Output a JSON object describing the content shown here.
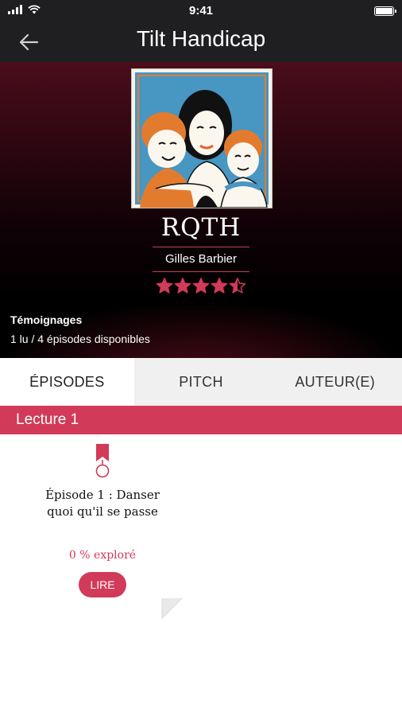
{
  "status_bar": {
    "time": "9:41"
  },
  "nav": {
    "title": "Tilt Handicap",
    "back_icon": "arrow-left-icon"
  },
  "book": {
    "title": "RQTH",
    "author": "Gilles Barbier",
    "rating": 4.5,
    "rating_max": 5,
    "genre": "Témoignages",
    "progress": "1 lu / 4 épisodes disponibles",
    "cover_icon": "illustrated-cover-three-people"
  },
  "tabs": [
    {
      "label": "ÉPISODES",
      "active": true
    },
    {
      "label": "PITCH",
      "active": false
    },
    {
      "label": "AUTEUR(E)",
      "active": false
    }
  ],
  "section": {
    "title": "Lecture 1"
  },
  "episode": {
    "title": "Épisode 1 : Danser quoi qu'il se passe",
    "explored": "0 % exploré",
    "explored_fraction": 0,
    "button_label": "LIRE",
    "bookmark_icon": "bookmark-ribbon-icon"
  },
  "colors": {
    "accent": "#d13a58",
    "dark_bar": "#1f1f22",
    "hero_top": "#4a0d1c",
    "tab_inactive_bg": "#f0f0f0"
  }
}
